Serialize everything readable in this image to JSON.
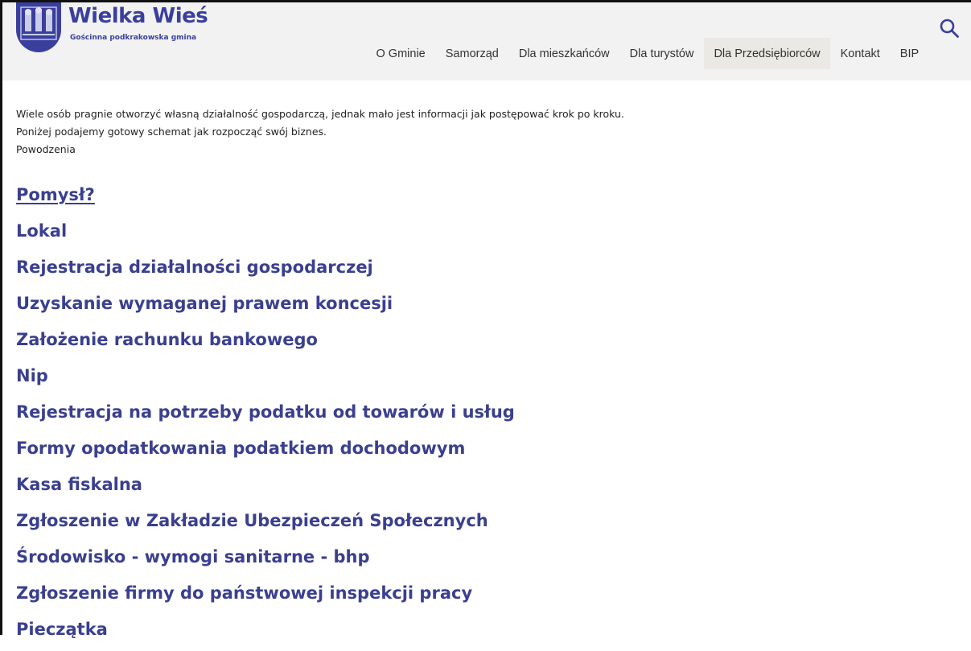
{
  "site": {
    "name": "Wielka Wieś",
    "tagline": "Gościnna podkrakowska gmina"
  },
  "nav": {
    "items": [
      {
        "label": "O Gminie",
        "active": false
      },
      {
        "label": "Samorząd",
        "active": false
      },
      {
        "label": "Dla mieszkańców",
        "active": false
      },
      {
        "label": "Dla turystów",
        "active": false
      },
      {
        "label": "Dla Przedsiębiorców",
        "active": true
      },
      {
        "label": "Kontakt",
        "active": false
      },
      {
        "label": "BIP",
        "active": false
      }
    ]
  },
  "intro": {
    "lines": [
      "Wiele osób pragnie otworzyć własną działalność gospodarczą, jednak mało jest informacji jak postępować krok po kroku.",
      "Poniżej podajemy gotowy schemat jak rozpocząć swój biznes.",
      "Powodzenia"
    ]
  },
  "topics": [
    "Pomysł?",
    "Lokal",
    "Rejestracja działalności gospodarczej",
    "Uzyskanie wymaganej prawem koncesji",
    "Założenie rachunku bankowego",
    "Nip",
    "Rejestracja na potrzeby podatku od towarów i usług",
    "Formy opodatkowania podatkiem dochodowym",
    "Kasa fiskalna",
    "Zgłoszenie w Zakładzie Ubezpieczeń Społecznych",
    "Środowisko - wymogi sanitarne - bhp",
    "Zgłoszenie firmy do państwowej inspekcji pracy",
    "Pieczątka"
  ],
  "colors": {
    "brand": "#3a3f9e",
    "link": "#3a3f8f",
    "header_bg": "#f2f2f2",
    "active_nav_bg": "#ebe9e4"
  },
  "icons": {
    "logo": "coat-of-arms-icon",
    "search": "search-icon"
  }
}
